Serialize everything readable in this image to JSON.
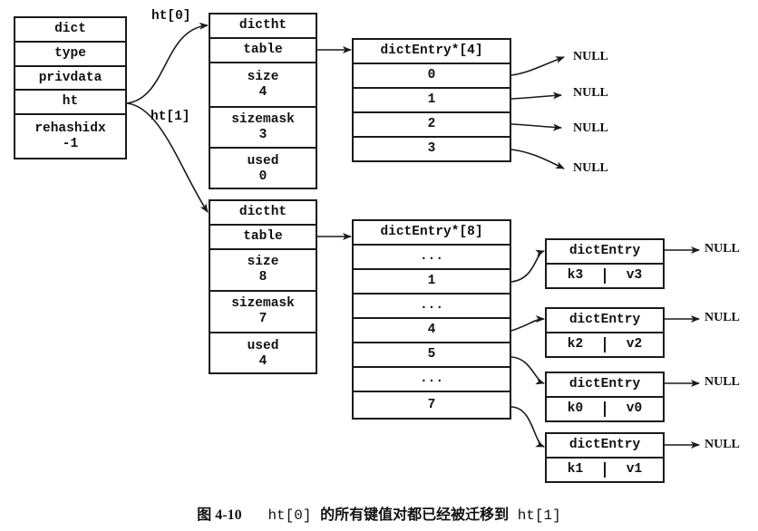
{
  "dict": {
    "title": "dict",
    "fields": [
      "type",
      "privdata",
      "ht"
    ],
    "rehashidx_label": "rehashidx",
    "rehashidx_value": "-1"
  },
  "pointer_labels": {
    "ht0": "ht[0]",
    "ht1": "ht[1]"
  },
  "dictht": [
    {
      "title": "dictht",
      "table_label": "table",
      "size_label": "size",
      "size": "4",
      "sizemask_label": "sizemask",
      "sizemask": "3",
      "used_label": "used",
      "used": "0"
    },
    {
      "title": "dictht",
      "table_label": "table",
      "size_label": "size",
      "size": "8",
      "sizemask_label": "sizemask",
      "sizemask": "7",
      "used_label": "used",
      "used": "4"
    }
  ],
  "tables": [
    {
      "title": "dictEntry*[4]",
      "slots": [
        "0",
        "1",
        "2",
        "3"
      ]
    },
    {
      "title": "dictEntry*[8]",
      "slots": [
        "...",
        "1",
        "...",
        "4",
        "5",
        "...",
        "7"
      ]
    }
  ],
  "null_label": "NULL",
  "entries": [
    {
      "title": "dictEntry",
      "key": "k3",
      "value": "v3",
      "from_slot": "1"
    },
    {
      "title": "dictEntry",
      "key": "k2",
      "value": "v2",
      "from_slot": "4"
    },
    {
      "title": "dictEntry",
      "key": "k0",
      "value": "v0",
      "from_slot": "5"
    },
    {
      "title": "dictEntry",
      "key": "k1",
      "value": "v1",
      "from_slot": "7"
    }
  ],
  "caption": {
    "figure": "图 4-10",
    "code1": "ht[0]",
    "text": "的所有键值对都已经被迁移到",
    "code2": "ht[1]"
  }
}
